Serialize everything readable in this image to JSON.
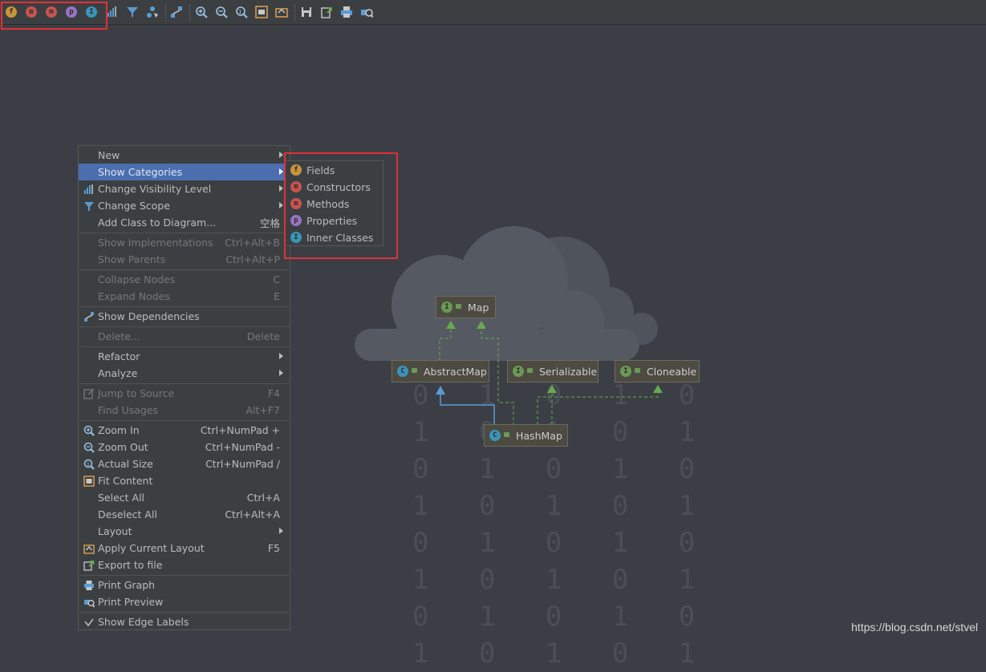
{
  "toolbar": {
    "category_icons": [
      {
        "name": "fields-icon",
        "letter": "f",
        "color": "#c9953a"
      },
      {
        "name": "constructors-icon",
        "letter": "m",
        "color": "#c75450"
      },
      {
        "name": "methods-icon",
        "letter": "m",
        "color": "#c75450"
      },
      {
        "name": "properties-icon",
        "letter": "p",
        "color": "#9a73c4"
      },
      {
        "name": "inner-classes-icon",
        "letter": "I",
        "color": "#3b93b8"
      }
    ]
  },
  "menu": {
    "items": [
      {
        "label": "New",
        "shortcut": "",
        "submenu": true,
        "disabled": false
      },
      {
        "label": "Show Categories",
        "shortcut": "",
        "submenu": true,
        "disabled": false,
        "selected": true
      },
      {
        "label": "Change Visibility Level",
        "shortcut": "",
        "submenu": true,
        "disabled": false,
        "icon": "visibility-icon"
      },
      {
        "label": "Change Scope",
        "shortcut": "",
        "submenu": true,
        "disabled": false,
        "icon": "filter-icon"
      },
      {
        "label": "Add Class to Diagram...",
        "shortcut": "空格",
        "submenu": false,
        "disabled": false
      },
      {
        "label": "Show Implementations",
        "shortcut": "Ctrl+Alt+B",
        "disabled": true
      },
      {
        "label": "Show Parents",
        "shortcut": "Ctrl+Alt+P",
        "disabled": true
      },
      {
        "label": "Collapse Nodes",
        "shortcut": "C",
        "disabled": true
      },
      {
        "label": "Expand Nodes",
        "shortcut": "E",
        "disabled": true
      },
      {
        "label": "Show Dependencies",
        "shortcut": "",
        "disabled": false,
        "icon": "dependencies-icon"
      },
      {
        "label": "Delete...",
        "shortcut": "Delete",
        "disabled": true
      },
      {
        "label": "Refactor",
        "shortcut": "",
        "submenu": true,
        "disabled": false
      },
      {
        "label": "Analyze",
        "shortcut": "",
        "submenu": true,
        "disabled": false
      },
      {
        "label": "Jump to Source",
        "shortcut": "F4",
        "disabled": true,
        "icon": "jump-source-icon"
      },
      {
        "label": "Find Usages",
        "shortcut": "Alt+F7",
        "disabled": true
      },
      {
        "label": "Zoom In",
        "shortcut": "Ctrl+NumPad +",
        "disabled": false,
        "icon": "zoom-in-icon"
      },
      {
        "label": "Zoom Out",
        "shortcut": "Ctrl+NumPad -",
        "disabled": false,
        "icon": "zoom-out-icon"
      },
      {
        "label": "Actual Size",
        "shortcut": "Ctrl+NumPad /",
        "disabled": false,
        "icon": "actual-size-icon"
      },
      {
        "label": "Fit Content",
        "shortcut": "",
        "disabled": false,
        "icon": "fit-content-icon"
      },
      {
        "label": "Select All",
        "shortcut": "Ctrl+A",
        "disabled": false
      },
      {
        "label": "Deselect All",
        "shortcut": "Ctrl+Alt+A",
        "disabled": false
      },
      {
        "label": "Layout",
        "shortcut": "",
        "submenu": true,
        "disabled": false
      },
      {
        "label": "Apply Current Layout",
        "shortcut": "F5",
        "disabled": false,
        "icon": "apply-layout-icon"
      },
      {
        "label": "Export to file",
        "shortcut": "",
        "disabled": false,
        "icon": "export-icon"
      },
      {
        "label": "Print Graph",
        "shortcut": "",
        "disabled": false,
        "icon": "print-icon"
      },
      {
        "label": "Print Preview",
        "shortcut": "",
        "disabled": false,
        "icon": "print-preview-icon"
      },
      {
        "label": "Show Edge Labels",
        "shortcut": "",
        "disabled": false,
        "checked": true
      }
    ]
  },
  "submenu": {
    "items": [
      {
        "label": "Fields",
        "letter": "f",
        "color": "#c9953a"
      },
      {
        "label": "Constructors",
        "letter": "m",
        "color": "#c75450"
      },
      {
        "label": "Methods",
        "letter": "m",
        "color": "#c75450"
      },
      {
        "label": "Properties",
        "letter": "p",
        "color": "#9a73c4"
      },
      {
        "label": "Inner Classes",
        "letter": "I",
        "color": "#3b93b8"
      }
    ]
  },
  "diagram": {
    "nodes": [
      {
        "name": "map",
        "label": "Map",
        "kind": "I",
        "color": "#6a9955"
      },
      {
        "name": "abstractmap",
        "label": "AbstractMap",
        "kind": "C",
        "color": "#3b93b8"
      },
      {
        "name": "serializable",
        "label": "Serializable",
        "kind": "I",
        "color": "#6a9955"
      },
      {
        "name": "cloneable",
        "label": "Cloneable",
        "kind": "I",
        "color": "#6a9955"
      },
      {
        "name": "hashmap",
        "label": "HashMap",
        "kind": "C",
        "color": "#3b93b8"
      }
    ]
  },
  "watermark": "https://blog.csdn.net/stvel"
}
